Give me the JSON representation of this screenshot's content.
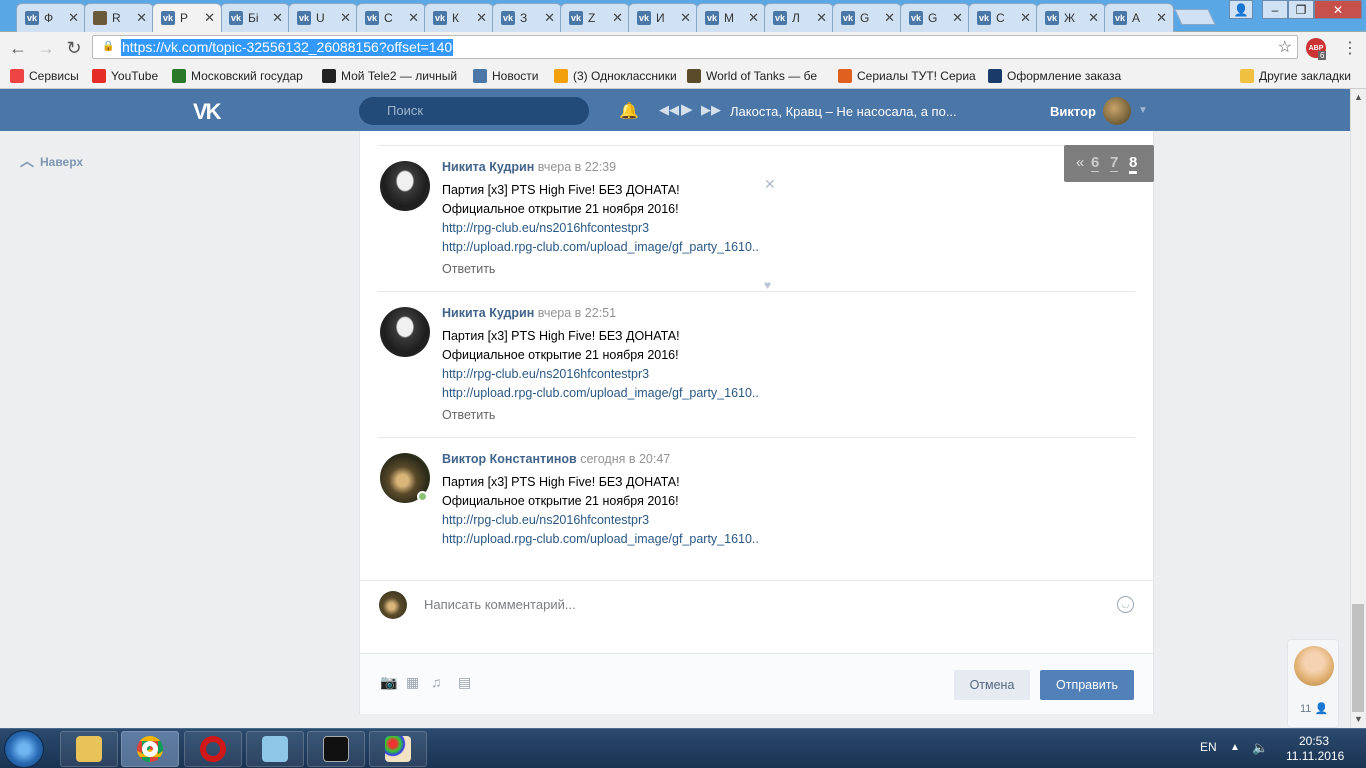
{
  "browser": {
    "tabs": [
      {
        "label": "Ф",
        "icon": "vk-icon"
      },
      {
        "label": "R",
        "icon": "game-icon"
      },
      {
        "label": "Р",
        "icon": "vk-icon"
      },
      {
        "label": "Бі",
        "icon": "vk-icon"
      },
      {
        "label": "U",
        "icon": "vk-icon"
      },
      {
        "label": "С",
        "icon": "vk-icon"
      },
      {
        "label": "К",
        "icon": "vk-icon"
      },
      {
        "label": "З",
        "icon": "vk-icon"
      },
      {
        "label": "Z",
        "icon": "vk-icon"
      },
      {
        "label": "И",
        "icon": "vk-icon"
      },
      {
        "label": "М",
        "icon": "vk-icon"
      },
      {
        "label": "Л",
        "icon": "vk-icon"
      },
      {
        "label": "G",
        "icon": "vk-icon"
      },
      {
        "label": "G",
        "icon": "vk-icon"
      },
      {
        "label": "С",
        "icon": "vk-icon"
      },
      {
        "label": "Ж",
        "icon": "vk-icon"
      },
      {
        "label": "А",
        "icon": "vk-icon"
      }
    ],
    "url": "https://vk.com/topic-32556132_26088156?offset=140",
    "abp_label": "ABP",
    "abp_count": "6",
    "bookmarks": [
      {
        "label": "Сервисы",
        "color": "#e44"
      },
      {
        "label": "YouTube",
        "color": "#e52d27"
      },
      {
        "label": "Московский государ",
        "color": "#2a7a2a"
      },
      {
        "label": "Мой Tele2 — личный",
        "color": "#222"
      },
      {
        "label": "Новости",
        "color": "#4a76a8"
      },
      {
        "label": "(3) Одноклассники",
        "color": "#f2a10c"
      },
      {
        "label": "World of Tanks — бе",
        "color": "#5a4a2a"
      },
      {
        "label": "Сериалы ТУТ! Сериа",
        "color": "#e06020"
      },
      {
        "label": "Оформление заказа",
        "color": "#1a3a6a"
      },
      {
        "label": "Другие закладки",
        "color": "#f0c040"
      }
    ]
  },
  "vk": {
    "logo": "VK",
    "search_placeholder": "Поиск",
    "now_playing": "Лакоста, Кравц – Не насосала, а по...",
    "user_name": "Виктор",
    "back_to_top": "Наверх",
    "pager": {
      "prev": "«",
      "pages": [
        "6",
        "7",
        "8"
      ],
      "current": "8"
    },
    "comments": [
      {
        "author": "Никита Кудрин",
        "date": "вчера в 22:39",
        "line1": "Партия [x3] PTS High Five! БЕЗ ДОНАТА!",
        "line2": "Официальное открытие 21 ноября 2016!",
        "link1": "http://rpg-club.eu/ns2016hfcontestpr3",
        "link2": "http://upload.rpg-club.com/upload_image/gf_party_1610..",
        "reply": "Ответить"
      },
      {
        "author": "Никита Кудрин",
        "date": "вчера в 22:51",
        "line1": "Партия [x3] PTS High Five! БЕЗ ДОНАТА!",
        "line2": "Официальное открытие 21 ноября 2016!",
        "link1": "http://rpg-club.eu/ns2016hfcontestpr3",
        "link2": "http://upload.rpg-club.com/upload_image/gf_party_1610..",
        "reply": "Ответить"
      },
      {
        "author": "Виктор Константинов",
        "date": "сегодня в 20:47",
        "line1": "Партия [x3] PTS High Five! БЕЗ ДОНАТА!",
        "line2": "Официальное открытие 21 ноября 2016!",
        "link1": "http://rpg-club.eu/ns2016hfcontestpr3",
        "link2": "http://upload.rpg-club.com/upload_image/gf_party_1610.."
      }
    ],
    "composer_placeholder": "Написать комментарий...",
    "cancel_label": "Отмена",
    "send_label": "Отправить",
    "chat_count": "11"
  },
  "taskbar": {
    "lang": "EN",
    "time": "20:53",
    "date": "11.11.2016"
  },
  "colors": {
    "vk_blue": "#4a76a8",
    "link": "#2a5885",
    "author": "#42648b",
    "send_button": "#5181b8"
  }
}
